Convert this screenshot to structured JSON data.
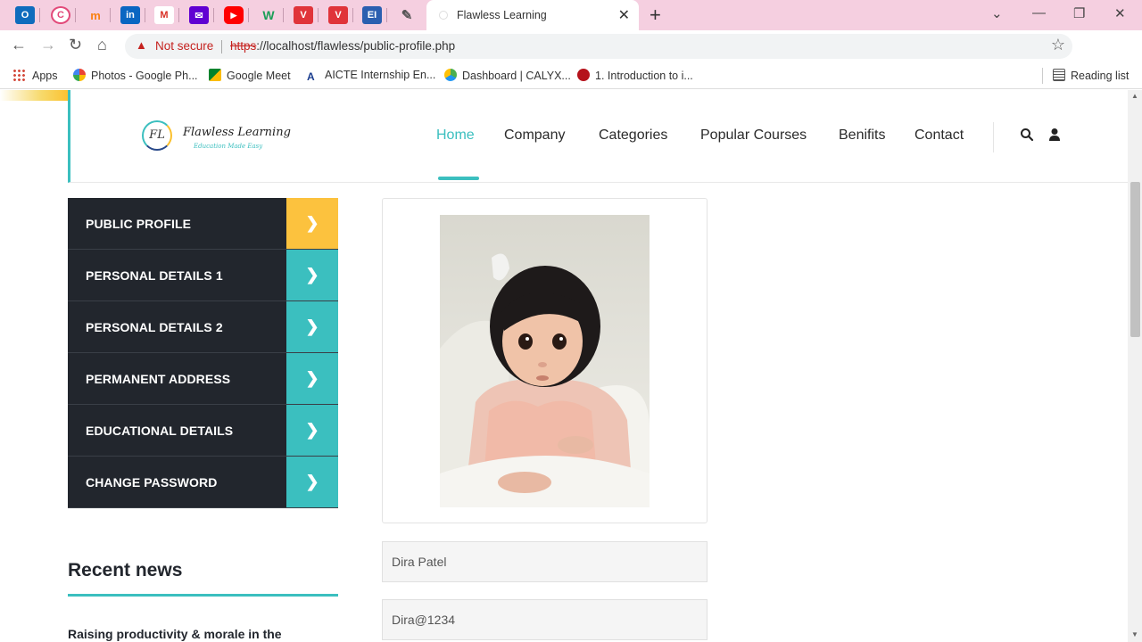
{
  "browser": {
    "tab_title": "Flawless Learning",
    "not_secure": "Not secure",
    "url_scheme": "https",
    "url_rest": "://localhost/flawless/public-profile.php",
    "bookmarks": [
      {
        "label": "Apps"
      },
      {
        "label": "Photos - Google Ph..."
      },
      {
        "label": "Google Meet"
      },
      {
        "label": "AICTE Internship En..."
      },
      {
        "label": "Dashboard | CALYX..."
      },
      {
        "label": "1. Introduction to i..."
      }
    ],
    "reading_list": "Reading list",
    "pinned_tabs": [
      "outlook",
      "canva",
      "moodle",
      "linkedin",
      "gmail",
      "yahoo-mail",
      "youtube",
      "wattpad",
      "vivaldi",
      "vivaldi",
      "word",
      "pen"
    ]
  },
  "site": {
    "logo": {
      "mark": "FL",
      "name": "Flawless Learning",
      "tagline": "Education Made Easy"
    },
    "nav": [
      "Home",
      "Company",
      "Categories",
      "Popular Courses",
      "Benifits",
      "Contact"
    ],
    "accent": "#3bbfbf",
    "highlight": "#fcc23e",
    "menu": [
      {
        "label": "PUBLIC PROFILE",
        "active": true
      },
      {
        "label": "PERSONAL DETAILS 1",
        "active": false
      },
      {
        "label": "PERSONAL DETAILS 2",
        "active": false
      },
      {
        "label": "PERMANENT ADDRESS",
        "active": false
      },
      {
        "label": "EDUCATIONAL DETAILS",
        "active": false
      },
      {
        "label": "CHANGE PASSWORD",
        "active": false
      }
    ],
    "recent_news": {
      "heading": "Recent news",
      "first_post": "Raising productivity & morale in the"
    },
    "profile": {
      "name": "Dira Patel",
      "password": "Dira@1234"
    }
  }
}
